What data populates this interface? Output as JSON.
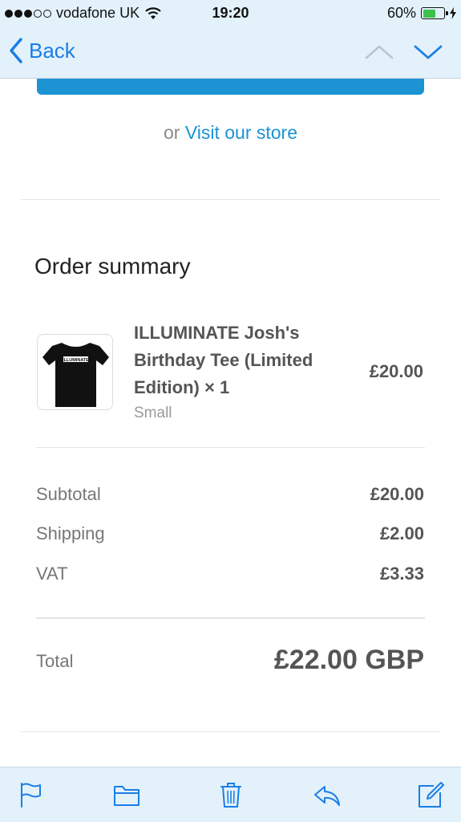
{
  "status_bar": {
    "carrier": "vodafone UK",
    "time": "19:20",
    "battery_percent": "60%",
    "battery_level": 0.6,
    "signal_bars_filled": 3,
    "signal_bars_total": 5
  },
  "nav": {
    "back_label": "Back",
    "icons": [
      "chevron-left-icon",
      "chevron-up-icon",
      "chevron-down-icon"
    ]
  },
  "email": {
    "visit_prefix": "or",
    "visit_link": "Visit our store",
    "order_summary_title": "Order summary",
    "product": {
      "name": "ILLUMINATE Josh's Birthday Tee (Limited Edition) × 1",
      "variant": "Small",
      "price": "£20.00",
      "shirt_print": "ILLUMINATE"
    },
    "subtotal_label": "Subtotal",
    "subtotal_value": "£20.00",
    "shipping_label": "Shipping",
    "shipping_value": "£2.00",
    "vat_label": "VAT",
    "vat_value": "£3.33",
    "total_label": "Total",
    "total_value": "£22.00 GBP"
  },
  "toolbar": {
    "icons": [
      "flag-icon",
      "folder-icon",
      "trash-icon",
      "reply-icon",
      "compose-icon"
    ]
  },
  "colors": {
    "accent": "#1a7ee6",
    "link": "#1c93d3",
    "bar_background": "#e3f1fb"
  }
}
